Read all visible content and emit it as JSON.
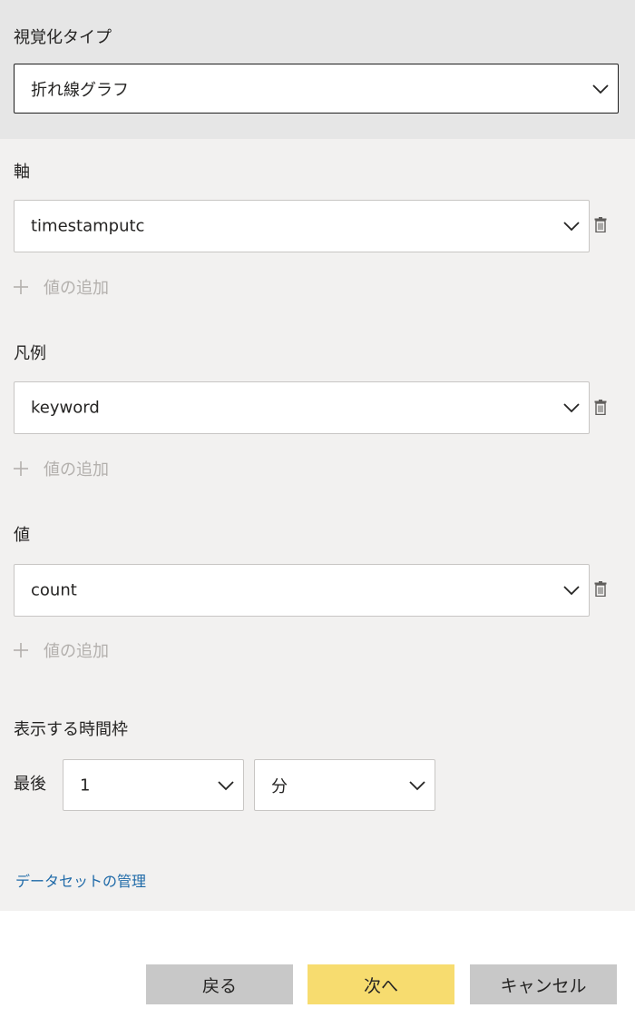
{
  "visualization": {
    "label": "視覚化タイプ",
    "value": "折れ線グラフ"
  },
  "axis": {
    "label": "軸",
    "value": "timestamputc",
    "add_label": "値の追加"
  },
  "legend": {
    "label": "凡例",
    "value": "keyword",
    "add_label": "値の追加"
  },
  "values": {
    "label": "値",
    "value": "count",
    "add_label": "値の追加"
  },
  "timeframe": {
    "label": "表示する時間枠",
    "last_label": "最後",
    "amount": "1",
    "unit": "分"
  },
  "manage_dataset_link": "データセットの管理",
  "buttons": {
    "back": "戻る",
    "next": "次へ",
    "cancel": "キャンセル"
  },
  "colors": {
    "link": "#1f6aa8",
    "next_button": "#f7dc6f",
    "secondary_button": "#c8c8c8",
    "panel_background": "#f2f1f0",
    "header_background": "#e6e6e6"
  },
  "icons": [
    "chevron-down-icon",
    "trash-icon",
    "plus-icon"
  ]
}
